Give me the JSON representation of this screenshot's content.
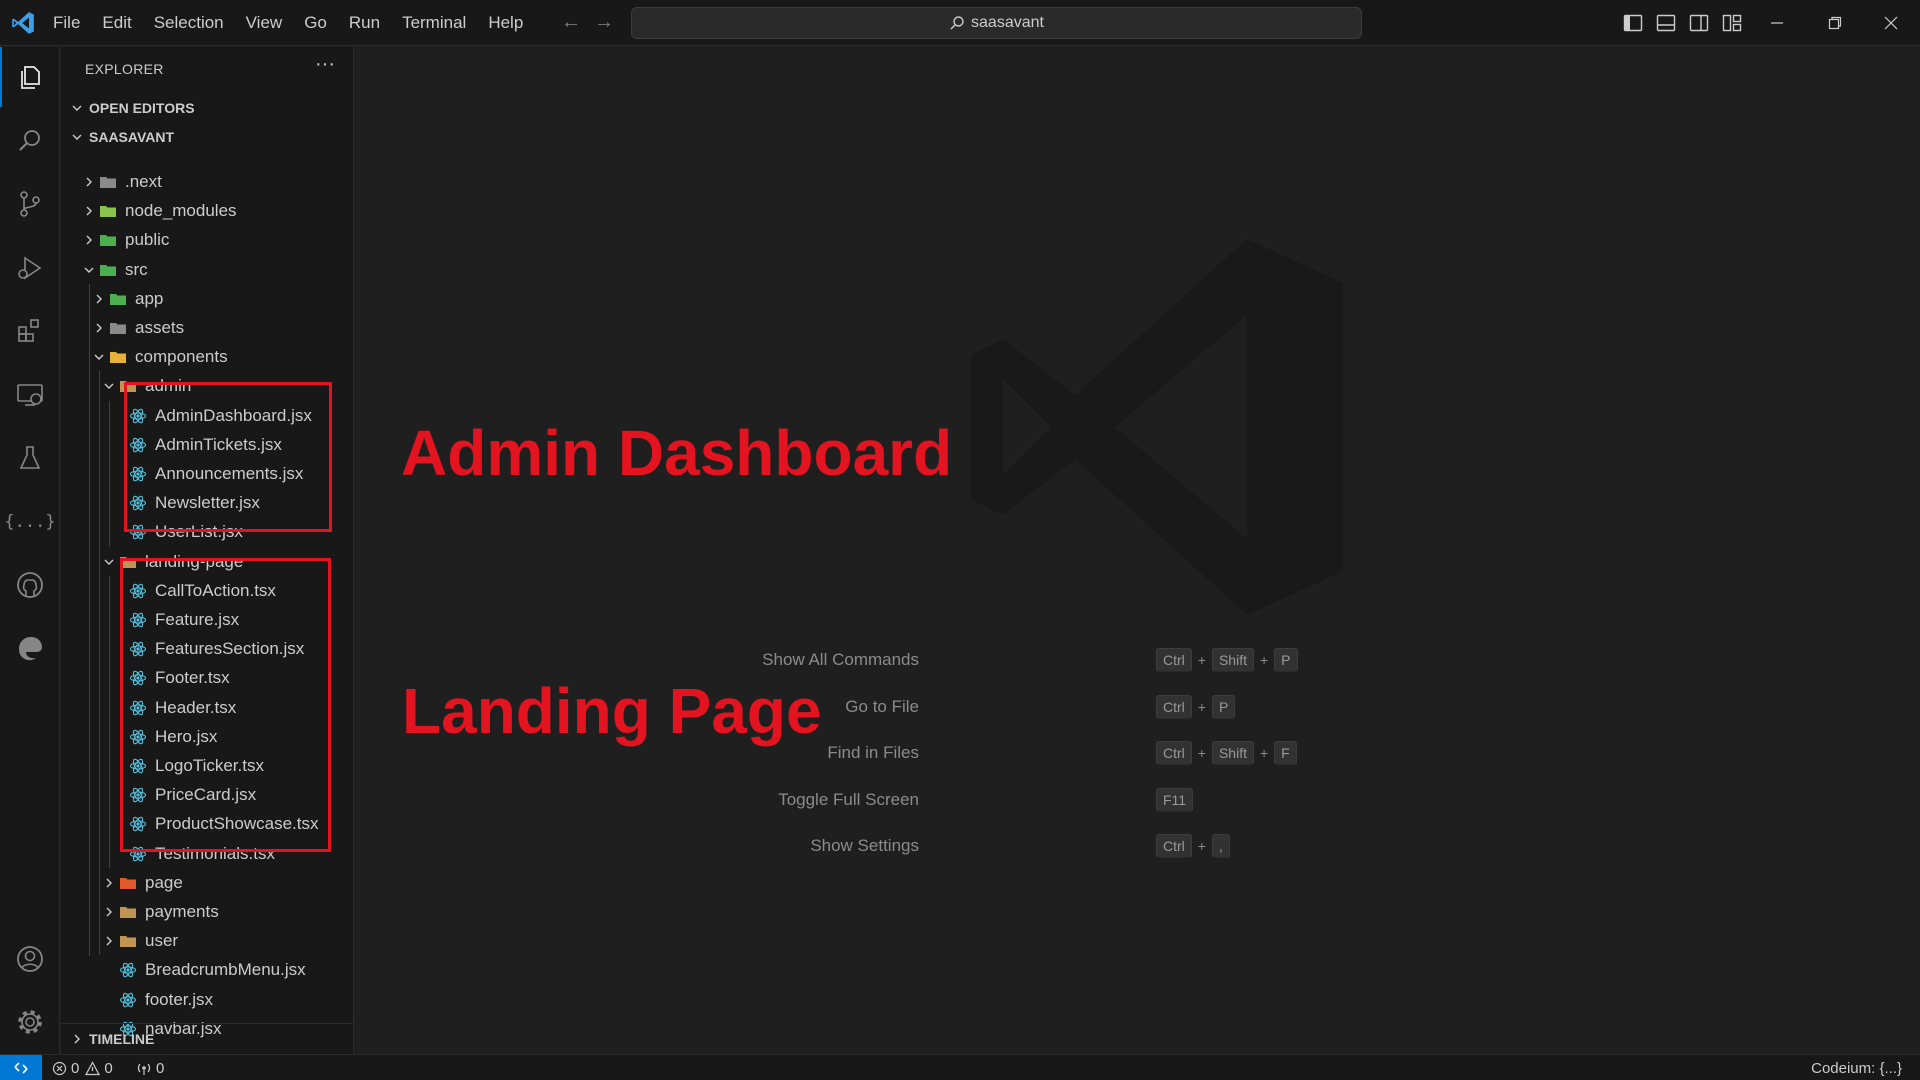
{
  "titlebar": {
    "menu": [
      "File",
      "Edit",
      "Selection",
      "View",
      "Go",
      "Run",
      "Terminal",
      "Help"
    ],
    "search_text": "saasavant"
  },
  "activity_bar": {
    "icons": [
      "explorer-icon",
      "search-icon",
      "source-control-icon",
      "run-debug-icon",
      "extensions-icon",
      "remote-explorer-icon",
      "testing-icon",
      "json-icon",
      "github-icon",
      "edge-icon",
      "account-icon",
      "settings-gear-icon"
    ]
  },
  "sidebar": {
    "title": "EXPLORER",
    "more": "···",
    "open_editors": "OPEN EDITORS",
    "project": "SAASAVANT",
    "tree": [
      {
        "name": ".next",
        "kind": "folder-next"
      },
      {
        "name": "node_modules",
        "kind": "folder-node"
      },
      {
        "name": "public",
        "kind": "folder-public"
      },
      {
        "name": "src",
        "kind": "folder-src"
      },
      {
        "name": "app",
        "kind": "folder-app"
      },
      {
        "name": "assets",
        "kind": "folder-assets"
      },
      {
        "name": "components",
        "kind": "folder-components"
      },
      {
        "name": "admin",
        "kind": "folder"
      },
      {
        "name": "AdminDashboard.jsx",
        "kind": "react"
      },
      {
        "name": "AdminTickets.jsx",
        "kind": "react"
      },
      {
        "name": "Announcements.jsx",
        "kind": "react"
      },
      {
        "name": "Newsletter.jsx",
        "kind": "react"
      },
      {
        "name": "UserList.jsx",
        "kind": "react"
      },
      {
        "name": "landing-page",
        "kind": "folder"
      },
      {
        "name": "CallToAction.tsx",
        "kind": "react"
      },
      {
        "name": "Feature.jsx",
        "kind": "react"
      },
      {
        "name": "FeaturesSection.jsx",
        "kind": "react"
      },
      {
        "name": "Footer.tsx",
        "kind": "react"
      },
      {
        "name": "Header.tsx",
        "kind": "react"
      },
      {
        "name": "Hero.jsx",
        "kind": "react"
      },
      {
        "name": "LogoTicker.tsx",
        "kind": "react"
      },
      {
        "name": "PriceCard.jsx",
        "kind": "react"
      },
      {
        "name": "ProductShowcase.tsx",
        "kind": "react"
      },
      {
        "name": "Testimonials.tsx",
        "kind": "react"
      },
      {
        "name": "page",
        "kind": "folder-page"
      },
      {
        "name": "payments",
        "kind": "folder"
      },
      {
        "name": "user",
        "kind": "folder"
      },
      {
        "name": "BreadcrumbMenu.jsx",
        "kind": "react"
      },
      {
        "name": "footer.jsx",
        "kind": "react"
      },
      {
        "name": "navbar.jsx",
        "kind": "react"
      }
    ],
    "timeline": "TIMELINE"
  },
  "editor": {
    "annotations": [
      "Admin Dashboard",
      "Landing Page"
    ],
    "annotation_color": "#e3141f",
    "shortcuts": [
      {
        "label": "Show All Commands",
        "keys": [
          "Ctrl",
          "Shift",
          "P"
        ]
      },
      {
        "label": "Go to File",
        "keys": [
          "Ctrl",
          "P"
        ]
      },
      {
        "label": "Find in Files",
        "keys": [
          "Ctrl",
          "Shift",
          "F"
        ]
      },
      {
        "label": "Toggle Full Screen",
        "keys": [
          "F11"
        ]
      },
      {
        "label": "Show Settings",
        "keys": [
          "Ctrl",
          ","
        ]
      }
    ]
  },
  "statusbar": {
    "errors": "0",
    "warnings": "0",
    "ports": "0",
    "right": "Codeium: {...}",
    "accent": "#0078d4"
  }
}
